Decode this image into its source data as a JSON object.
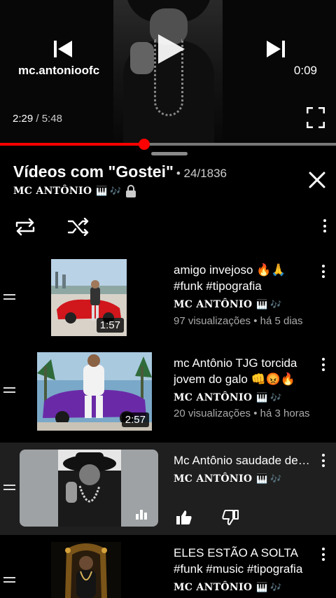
{
  "player": {
    "channel": "mc.antonioofc",
    "top_time": "0:09",
    "current_time": "2:29",
    "separator": "/",
    "duration": "5:48",
    "progress": 0.43,
    "accent_color": "#ff0000"
  },
  "playlist": {
    "title": "Vídeos com \"Gostei\"",
    "position": "• 24/1836",
    "owner": "MC ANTÔNIO",
    "owner_emoji": "🎹 🎶",
    "icons": [
      "close-icon",
      "lock-icon",
      "loop-icon",
      "shuffle-icon",
      "more-vert-icon"
    ]
  },
  "items": [
    {
      "title": "amigo invejoso 🔥🙏 #funk #tipografia",
      "channel": "MC ANTÔNIO",
      "channel_emoji": "🎹 🎶",
      "meta": "97 visualizações • há 5 dias",
      "duration": "1:57"
    },
    {
      "title": "mc Antônio TJG torcida jovem do galo 👊😡🔥",
      "channel": "MC ANTÔNIO",
      "channel_emoji": "🎹 🎶",
      "meta": "20 visualizações • há 3 horas",
      "duration": "2:57"
    },
    {
      "title": "Mc Antônio saudade de você",
      "channel": "MC ANTÔNIO",
      "channel_emoji": "🎹 🎶",
      "now_playing": true,
      "icons": [
        "like-icon",
        "dislike-icon",
        "equalizer-icon"
      ]
    },
    {
      "title": "ELES ESTÃO A SOLTA #funk #music #tipografia",
      "channel": "MC ANTÔNIO",
      "channel_emoji": "🎹 🎶"
    }
  ]
}
